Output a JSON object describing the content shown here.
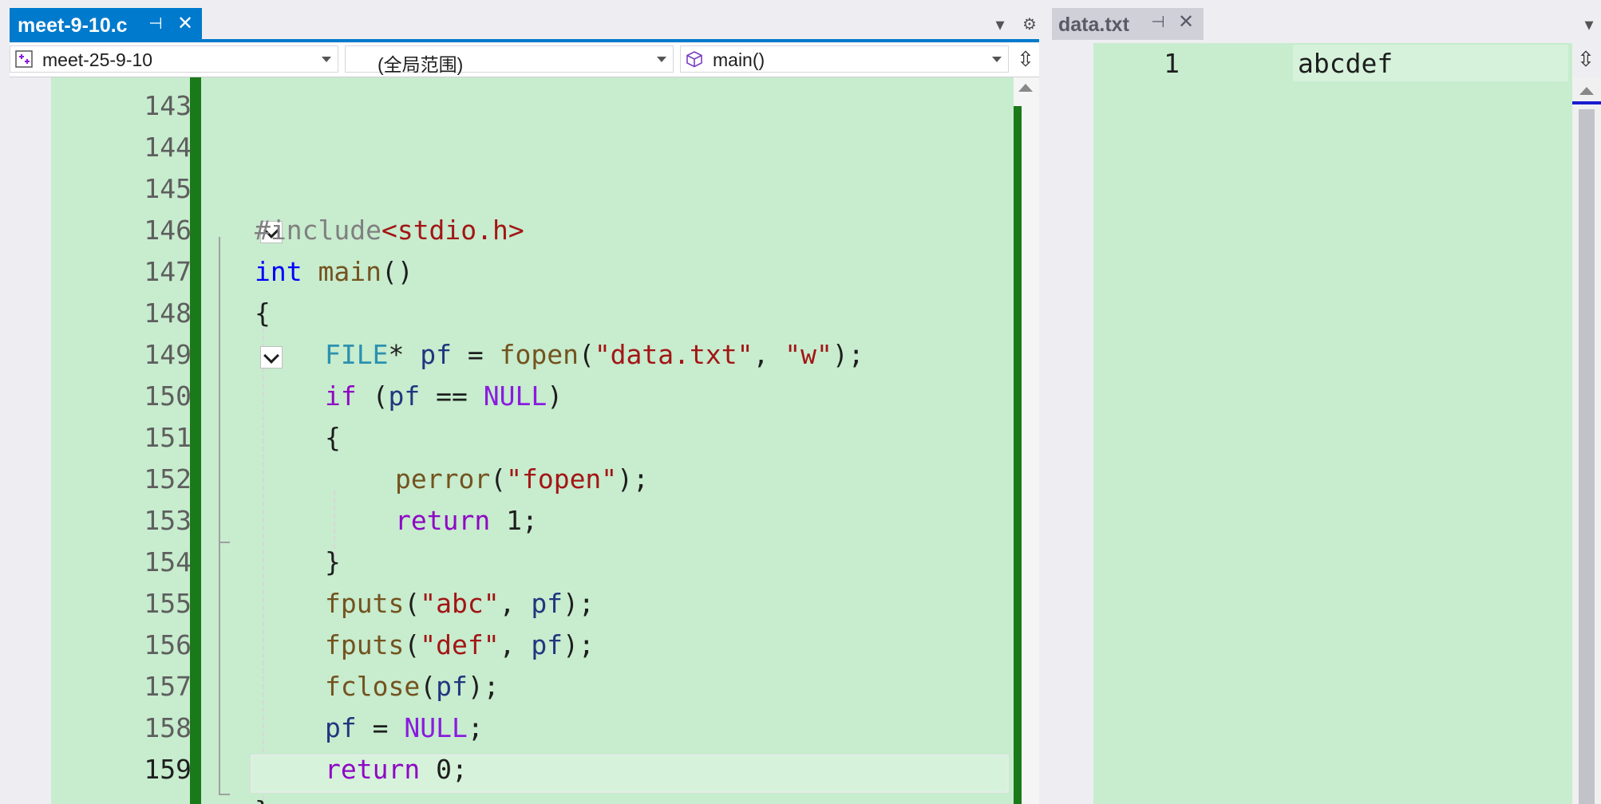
{
  "left": {
    "tab": {
      "title": "meet-9-10.c",
      "pin": "⊣",
      "close": "✕"
    },
    "strip": {
      "dropdown": "▾",
      "settings": "⚙"
    },
    "nav": {
      "project": "meet-25-9-10",
      "scope": "(全局范围)",
      "member": "main()",
      "split": "⇳"
    },
    "lines": [
      {
        "n": "143"
      },
      {
        "n": "144"
      },
      {
        "n": "145"
      },
      {
        "n": "146"
      },
      {
        "n": "147"
      },
      {
        "n": "148"
      },
      {
        "n": "149"
      },
      {
        "n": "150"
      },
      {
        "n": "151"
      },
      {
        "n": "152"
      },
      {
        "n": "153"
      },
      {
        "n": "154"
      },
      {
        "n": "155"
      },
      {
        "n": "156"
      },
      {
        "n": "157"
      },
      {
        "n": "158"
      },
      {
        "n": "159"
      }
    ],
    "code": {
      "l145_pp": "#include",
      "l145_inc": "<stdio.h>",
      "l146_kw": "int",
      "l146_fn": "main",
      "l146_rest": "()",
      "l147": "{",
      "l148_ty": "FILE",
      "l148_a": "* ",
      "l148_var": "pf",
      "l148_b": " = ",
      "l148_fn": "fopen",
      "l148_c": "(",
      "l148_s1": "\"data.txt\"",
      "l148_d": ", ",
      "l148_s2": "\"w\"",
      "l148_e": ");",
      "l149_kw": "if",
      "l149_a": " (",
      "l149_var": "pf",
      "l149_b": " == ",
      "l149_mac": "NULL",
      "l149_c": ")",
      "l150": "{",
      "l151_fn": "perror",
      "l151_a": "(",
      "l151_s": "\"fopen\"",
      "l151_b": ");",
      "l152_kw": "return",
      "l152_a": " 1;",
      "l153": "}",
      "l154_fn": "fputs",
      "l154_a": "(",
      "l154_s": "\"abc\"",
      "l154_b": ", ",
      "l154_var": "pf",
      "l154_c": ");",
      "l155_fn": "fputs",
      "l155_a": "(",
      "l155_s": "\"def\"",
      "l155_b": ", ",
      "l155_var": "pf",
      "l155_c": ");",
      "l156_fn": "fclose",
      "l156_a": "(",
      "l156_var": "pf",
      "l156_b": ");",
      "l157_var": "pf",
      "l157_a": " = ",
      "l157_mac": "NULL",
      "l157_b": ";",
      "l158_kw": "return",
      "l158_a": " 0;",
      "l159": "}"
    }
  },
  "right": {
    "tab": {
      "title": "data.txt",
      "pin": "⊣",
      "close": "✕"
    },
    "strip": {
      "dropdown": "▾"
    },
    "split": "⇳",
    "line_number": "1",
    "content": "abcdef"
  },
  "colors": {
    "accent": "#007acc",
    "editor_bg": "#c7ecce",
    "change_bar": "#1a7a1a"
  }
}
